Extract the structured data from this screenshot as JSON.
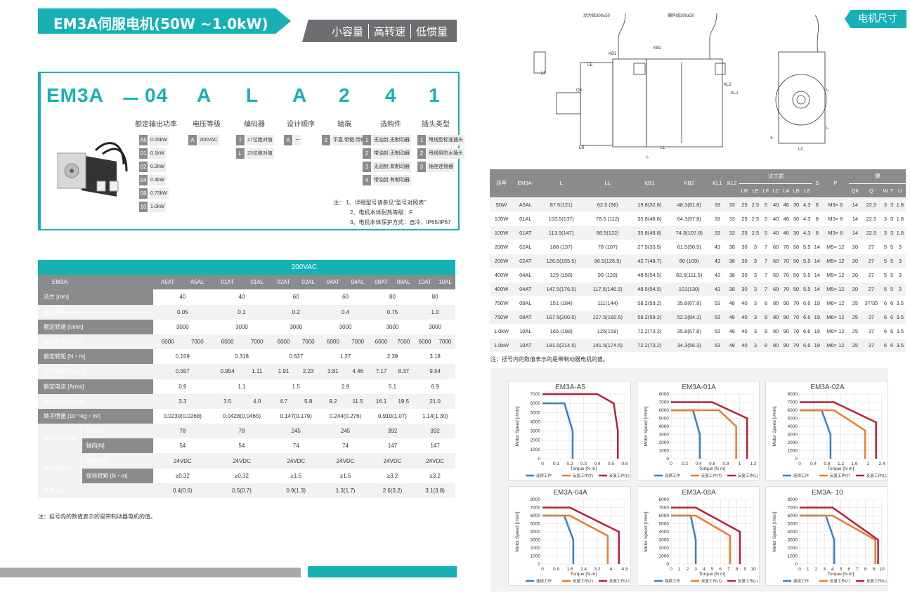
{
  "header": {
    "title": "EM3A伺服电机(50W ~1.0kW)",
    "tags": [
      "小容量",
      "高转速",
      "低惯量"
    ],
    "right_tag": "电机尺寸"
  },
  "model": {
    "code": [
      "EM3A",
      "－",
      "04",
      "A",
      "L",
      "A",
      "2",
      "4",
      "1"
    ],
    "labels": [
      "额定输出功率",
      "电压等级",
      "编码器",
      "设计顺序",
      "轴端",
      "选购件",
      "插头类型"
    ],
    "power_opts": [
      [
        "A5",
        "0.05kW"
      ],
      [
        "01",
        "0.1kW"
      ],
      [
        "02",
        "0.2kW"
      ],
      [
        "04",
        "0.4kW"
      ],
      [
        "08",
        "0.75kW"
      ],
      [
        "10",
        "1.0kW"
      ]
    ],
    "voltage_opts": [
      [
        "A",
        "200VAC"
      ]
    ],
    "encoder_opts": [
      [
        "T",
        "17位绝对值"
      ],
      [
        "L",
        "23位绝对值"
      ]
    ],
    "design_opts": [
      [
        "A",
        "－"
      ]
    ],
    "shaft_opts": [
      [
        "2",
        "平直,带键,带螺纹"
      ]
    ],
    "option_opts": [
      [
        "1",
        "无油封,无制动器"
      ],
      [
        "2",
        "带油封,无制动器"
      ],
      [
        "3",
        "无油封,有制动器"
      ],
      [
        "4",
        "带油封,有制动器"
      ]
    ],
    "plug_opts": [
      [
        "1",
        "甩线型标准插头"
      ],
      [
        "2",
        "甩线型防水插头"
      ],
      [
        "3",
        "插座连接器"
      ]
    ],
    "notes": [
      "注：  1、详细型号请参见“型号对照表”",
      "2、电机本体耐热等级：F",
      "3、电机本体保护方式：自冷、IP65/IP67"
    ]
  },
  "spec": {
    "voltage": "200VAC",
    "model_label": "EM3A-",
    "models": [
      "A5AT",
      "A5AL",
      "01AT",
      "01AL",
      "02AT",
      "02AL",
      "04AT",
      "04AL",
      "08AT",
      "08AL",
      "10AT",
      "10AL"
    ],
    "rows": [
      {
        "label": "法兰 [mm]",
        "vals": [
          "40",
          "40",
          "60",
          "60",
          "80",
          "80"
        ]
      },
      {
        "label": "额定功率 [kW]",
        "vals": [
          "0.05",
          "0.1",
          "0.2",
          "0.4",
          "0.75",
          "1.0"
        ]
      },
      {
        "label": "额定转速 [r/min]",
        "vals": [
          "3000",
          "3000",
          "3000",
          "3000",
          "3000",
          "3000"
        ]
      },
      {
        "label": "最大转速 [r/min]",
        "vals2": [
          "6000",
          "7000",
          "6000",
          "7000",
          "6000",
          "7000",
          "6000",
          "7000",
          "6000",
          "7000",
          "6000",
          "7000"
        ]
      },
      {
        "label": "额定转矩 [N・m]",
        "vals": [
          "0.159",
          "0.318",
          "0.637",
          "1.27",
          "2.39",
          "3.18"
        ]
      },
      {
        "label": "最大转矩 [N・m]",
        "vals2": [
          "0.557",
          "",
          "0.954",
          "1.11",
          "1.91",
          "2.23",
          "3.81",
          "4.46",
          "7.17",
          "8.37",
          "9.54",
          ""
        ]
      },
      {
        "label": "额定电流 [Arms]",
        "vals": [
          "0.9",
          "1.1",
          "1.5",
          "2.9",
          "5.1",
          "6.9"
        ]
      },
      {
        "label": "最大电流 [Arms]",
        "vals2": [
          "3.3",
          "",
          "3.5",
          "4.0",
          "4.7",
          "5.8",
          "9.2",
          "11.5",
          "16.1",
          "19.5",
          "21.0",
          ""
        ]
      },
      {
        "label": "转子惯量 [10⁻⁴kg・m²]",
        "vals": [
          "0.0230(0.0268)",
          "0.0428(0.0465)",
          "0.147(0.179)",
          "0.244(0.276)",
          "0.910(1.07)",
          "1.14(1.30)"
        ]
      }
    ],
    "load_group": "轴端容许负荷",
    "load_rows": [
      {
        "label": "径向[N]",
        "vals": [
          "78",
          "78",
          "245",
          "245",
          "392",
          "392"
        ]
      },
      {
        "label": "轴向[N]",
        "vals": [
          "54",
          "54",
          "74",
          "74",
          "147",
          "147"
        ]
      }
    ],
    "brake_group": "制动器规格",
    "brake_rows": [
      {
        "label": "额定电压",
        "vals": [
          "24VDC",
          "24VDC",
          "24VDC",
          "24VDC",
          "24VDC",
          "24VDC"
        ]
      },
      {
        "label": "保持转矩 [N・m]",
        "vals": [
          "≥0.32",
          "≥0.32",
          "≥1.5",
          "≥1.5",
          "≥3.2",
          "≥3.2"
        ]
      }
    ],
    "weight": {
      "label": "重量 [kg]",
      "vals": [
        "0.4(0.6)",
        "0.5(0.7)",
        "0.9(1.3)",
        "1.3(1.7)",
        "2.6(3.2)",
        "3.1(3.8)"
      ]
    },
    "note": "注：括号内的数值表示的是带制动器电机的值。"
  },
  "dims": {
    "head1": [
      "功率",
      "EM3A-",
      "L",
      "LL",
      "KB1",
      "KB2",
      "KL1",
      "KL2",
      "法兰面",
      "S",
      "P",
      "键"
    ],
    "head2": [
      "LR",
      "LE",
      "LF",
      "LC",
      "LA",
      "LB",
      "LZ",
      "QK",
      "Q",
      "W",
      "T",
      "U"
    ],
    "rows": [
      [
        "50W",
        "A5AL",
        "87.5(121)",
        "62.5 (96)",
        "19.8(32.8)",
        "48.3(81.8)",
        "33",
        "33",
        "25",
        "2.5",
        "5",
        "40",
        "46",
        "30",
        "4.3",
        "8",
        "M3× 6",
        "14",
        "22.5",
        "3",
        "3",
        "1.8"
      ],
      [
        "100W",
        "01AL",
        "103.5(137)",
        "78.5 (112)",
        "35.8(48.8)",
        "64.3(97.8)",
        "33",
        "33",
        "25",
        "2.5",
        "5",
        "40",
        "46",
        "30",
        "4.3",
        "8",
        "M3× 6",
        "14",
        "22.5",
        "3",
        "3",
        "1.8"
      ],
      [
        "100W",
        "01AT",
        "113.5(147)",
        "88.5(122)",
        "35.8(48.8)",
        "74.3(107.8)",
        "33",
        "33",
        "25",
        "2.5",
        "5",
        "40",
        "46",
        "30",
        "4.3",
        "8",
        "M3× 6",
        "14",
        "22.5",
        "3",
        "3",
        "1.8"
      ],
      [
        "200W",
        "02AL",
        "108 (137)",
        "78 (107)",
        "27.5(33.5)",
        "61.5(90.5)",
        "43",
        "38",
        "30",
        "3",
        "7",
        "60",
        "70",
        "50",
        "5.5",
        "14",
        "M5× 12",
        "20",
        "27",
        "5",
        "5",
        "3"
      ],
      [
        "200W",
        "02AT",
        "126.5(155.5)",
        "96.5(125.5)",
        "42.7(48.7)",
        "80 (109)",
        "43",
        "38",
        "30",
        "3",
        "7",
        "60",
        "70",
        "50",
        "5.5",
        "14",
        "M5× 12",
        "20",
        "27",
        "5",
        "5",
        "3"
      ],
      [
        "400W",
        "04AL",
        "129 (158)",
        "99 (128)",
        "48.5(54.5)",
        "82.5(111.5)",
        "43",
        "38",
        "30",
        "3",
        "7",
        "60",
        "70",
        "50",
        "5.5",
        "14",
        "M5× 12",
        "20",
        "27",
        "5",
        "5",
        "3"
      ],
      [
        "400W",
        "04AT",
        "147.5(176.5)",
        "117.5(146.5)",
        "48.5(54.5)",
        "101(130)",
        "43",
        "38",
        "30",
        "3",
        "7",
        "60",
        "70",
        "50",
        "5.5",
        "14",
        "M5× 12",
        "20",
        "27",
        "5",
        "5",
        "3"
      ],
      [
        "750W",
        "08AL",
        "151 (184)",
        "111(144)",
        "58.2(59.2)",
        "35.8(67.8)",
        "53",
        "48",
        "40",
        "3",
        "8",
        "80",
        "90",
        "70",
        "6.6",
        "19",
        "M6× 12",
        "25",
        "37/35",
        "6",
        "6",
        "3.5"
      ],
      [
        "750W",
        "08AT",
        "167.5(200.5)",
        "127.5(160.5)",
        "58.2(59.2)",
        "52.3(84.3)",
        "53",
        "48",
        "40",
        "3",
        "8",
        "80",
        "90",
        "70",
        "6.6",
        "19",
        "M6× 12",
        "25",
        "37",
        "6",
        "6",
        "3.5"
      ],
      [
        "1.0kW",
        "10AL",
        "165 (198)",
        "125(158)",
        "72.2(73.2)",
        "35.8(67.8)",
        "53",
        "48",
        "40",
        "3",
        "8",
        "80",
        "90",
        "70",
        "6.6",
        "19",
        "M6× 12",
        "25",
        "37",
        "6",
        "6",
        "3.5"
      ],
      [
        "1.0kW",
        "10AT",
        "181.5(214.5)",
        "141.5(174.5)",
        "72.2(73.2)",
        "34.3(56.3)",
        "53",
        "48",
        "40",
        "3",
        "8",
        "80",
        "90",
        "70",
        "6.6",
        "19",
        "M6× 12",
        "25",
        "37",
        "6",
        "6",
        "3.5"
      ]
    ],
    "note": "注：括号内的数值表示的是带制动器电机的值。"
  },
  "drawing": {
    "labels": [
      "动力线300±50",
      "编码线300±50",
      "KB2",
      "KB1",
      "LE",
      "KL1",
      "KL2",
      "QK",
      "LR",
      "LL",
      "L",
      "LC",
      "LA",
      "LZ",
      "4-",
      "LF"
    ]
  },
  "legend": [
    "连续工作",
    "反复工作(T)",
    "反复工作(L)"
  ],
  "legend2": [
    "连续工作",
    "反复工作(T)",
    "反复工作(L)"
  ],
  "colors": {
    "teal": "#16b1b4",
    "blue": "#3a7ec2",
    "orange": "#e87e2c",
    "red": "#b8203a"
  },
  "chart_data": [
    {
      "type": "line",
      "title": "EM3A-A5",
      "xlabel": "Torque [N·m]",
      "ylabel": "Motor Speed [r/min]",
      "xlim": [
        0,
        0.6
      ],
      "xticks": [
        "0",
        "0.1",
        "0.2",
        "0.3",
        "0.4",
        "0.5",
        "0.6"
      ],
      "ylim": [
        0,
        7000
      ],
      "yticks": [
        "0",
        "1000",
        "2000",
        "3000",
        "4000",
        "5000",
        "6000",
        "7000"
      ],
      "series": [
        {
          "x": [
            0,
            0.16,
            0.22,
            0.22
          ],
          "y": [
            6000,
            6000,
            3000,
            0
          ]
        },
        {
          "x": [
            0,
            0.3,
            0.3
          ],
          "y": [
            7000,
            7000,
            7000
          ]
        },
        {
          "x": [
            0,
            0.4,
            0.52,
            0.55,
            0.55
          ],
          "y": [
            7000,
            7000,
            6000,
            3000,
            0
          ]
        }
      ]
    },
    {
      "type": "line",
      "title": "EM3A-01A",
      "xlabel": "Torque [N·m]",
      "ylabel": "Motor Speed [r/min]",
      "xlim": [
        0,
        1.2
      ],
      "xticks": [
        "0",
        "0.2",
        "0.4",
        "0.6",
        "0.8",
        "1",
        "1.2"
      ],
      "ylim": [
        0,
        8000
      ],
      "yticks": [
        "0",
        "1000",
        "2000",
        "3000",
        "4000",
        "5000",
        "6000",
        "7000",
        "8000"
      ],
      "series": [
        {
          "x": [
            0,
            0.32,
            0.42,
            0.42
          ],
          "y": [
            6000,
            6000,
            3000,
            0
          ]
        },
        {
          "x": [
            0,
            0.7,
            0.95,
            0.95
          ],
          "y": [
            6000,
            6000,
            4000,
            0
          ]
        },
        {
          "x": [
            0,
            0.6,
            1.11,
            1.11
          ],
          "y": [
            7000,
            7000,
            5000,
            0
          ]
        }
      ]
    },
    {
      "type": "line",
      "title": "EM3A-02A",
      "xlabel": "Torque [N·m]",
      "ylabel": "Motor Speed [r/min]",
      "xlim": [
        0,
        2.4
      ],
      "xticks": [
        "0",
        "0.4",
        "0.8",
        "1.2",
        "1.6",
        "2",
        "2.4"
      ],
      "ylim": [
        0,
        8000
      ],
      "yticks": [
        "0",
        "1000",
        "2000",
        "3000",
        "4000",
        "5000",
        "6000",
        "7000",
        "8000"
      ],
      "series": [
        {
          "x": [
            0,
            0.64,
            0.9,
            0.9
          ],
          "y": [
            6000,
            6000,
            3000,
            0
          ]
        },
        {
          "x": [
            0,
            1,
            1.91,
            1.91
          ],
          "y": [
            6000,
            6000,
            3500,
            0
          ]
        },
        {
          "x": [
            0,
            1,
            2.23,
            2.23
          ],
          "y": [
            7000,
            7000,
            4500,
            0
          ]
        }
      ]
    },
    {
      "type": "line",
      "title": "EM3A-04A",
      "xlabel": "Torque [N·m]",
      "ylabel": "Motor Speed [r/min]",
      "xlim": [
        0,
        4.8
      ],
      "xticks": [
        "0",
        "0.8",
        "1.6",
        "2.4",
        "3.2",
        "4",
        "4.8"
      ],
      "ylim": [
        0,
        8000
      ],
      "yticks": [
        "0",
        "1000",
        "2000",
        "3000",
        "4000",
        "5000",
        "6000",
        "7000",
        "8000"
      ],
      "series": [
        {
          "x": [
            0,
            1.27,
            1.8,
            1.8
          ],
          "y": [
            6000,
            6000,
            3000,
            0
          ]
        },
        {
          "x": [
            0,
            1.6,
            3.81,
            3.81
          ],
          "y": [
            6000,
            6000,
            3500,
            0
          ]
        },
        {
          "x": [
            0,
            1.6,
            4.46,
            4.46
          ],
          "y": [
            7000,
            7000,
            4000,
            0
          ]
        }
      ]
    },
    {
      "type": "line",
      "title": "EM3A-08A",
      "xlabel": "Torque [N·m]",
      "ylabel": "Motor Speed [r/min]",
      "xlim": [
        0,
        10
      ],
      "xticks": [
        "0",
        "1",
        "2",
        "3",
        "4",
        "5",
        "6",
        "7",
        "8",
        "9",
        "10"
      ],
      "ylim": [
        0,
        8000
      ],
      "yticks": [
        "0",
        "1000",
        "2000",
        "3000",
        "4000",
        "5000",
        "6000",
        "7000",
        "8000"
      ],
      "series": [
        {
          "x": [
            0,
            2.39,
            3,
            3
          ],
          "y": [
            6000,
            6000,
            3000,
            0
          ]
        },
        {
          "x": [
            0,
            3,
            7.17,
            7.17
          ],
          "y": [
            6000,
            6000,
            3500,
            0
          ]
        },
        {
          "x": [
            0,
            3,
            8.37,
            8.37
          ],
          "y": [
            7000,
            7000,
            4000,
            0
          ]
        }
      ]
    },
    {
      "type": "line",
      "title": "EM3A- 10",
      "xlabel": "Torque [N·m]",
      "ylabel": "Motor Speed [r/min]",
      "xlim": [
        0,
        10
      ],
      "xticks": [
        "0",
        "1",
        "2",
        "3",
        "4",
        "5",
        "6",
        "7",
        "8",
        "9",
        "10"
      ],
      "ylim": [
        0,
        8000
      ],
      "yticks": [
        "0",
        "1000",
        "2000",
        "3000",
        "4000",
        "5000",
        "6000",
        "7000",
        "8000"
      ],
      "series": [
        {
          "x": [
            0,
            3.18,
            4.2,
            4.2
          ],
          "y": [
            6000,
            6000,
            3000,
            0
          ]
        },
        {
          "x": [
            0,
            4,
            9.2,
            9.2
          ],
          "y": [
            6000,
            6000,
            3000,
            0
          ]
        },
        {
          "x": [
            0,
            4,
            9.54,
            9.54
          ],
          "y": [
            7000,
            7000,
            3000,
            0
          ]
        }
      ]
    }
  ]
}
